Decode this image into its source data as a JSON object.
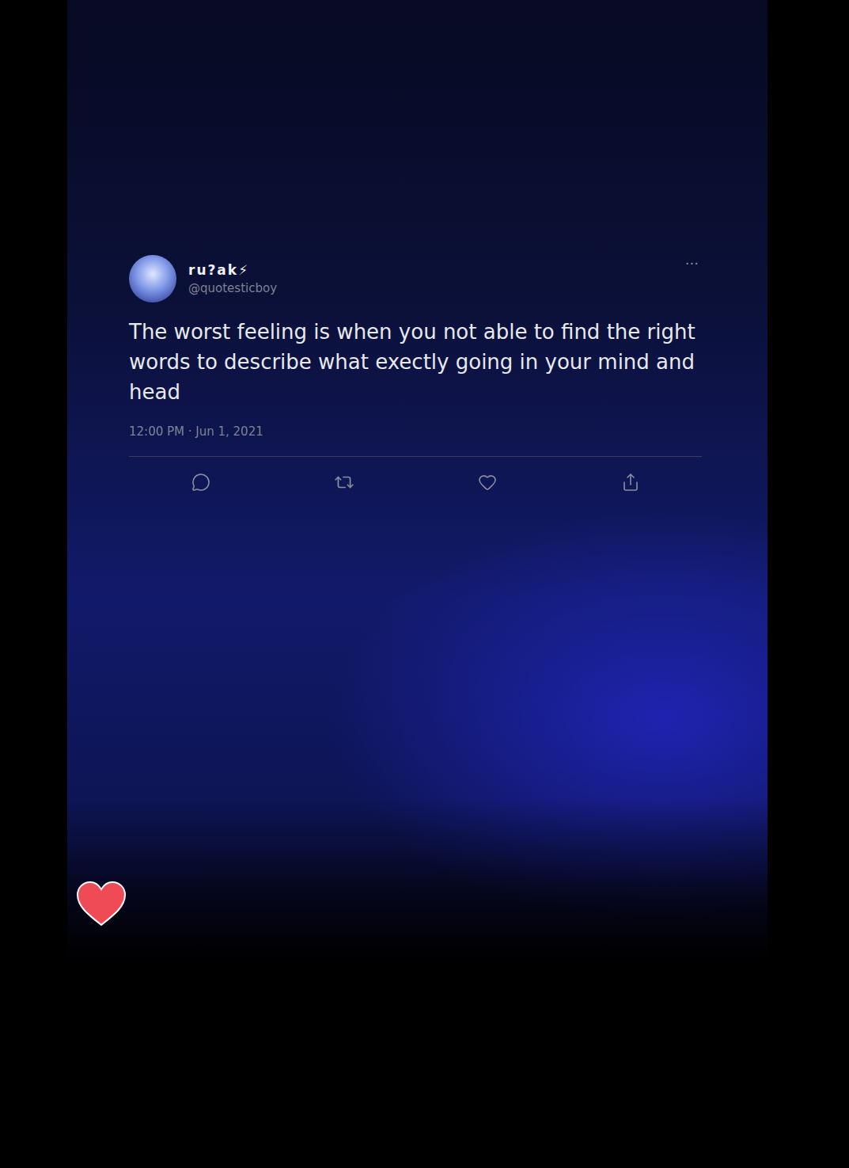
{
  "tweet": {
    "display_name": "ru?ak⚡",
    "handle": "@quotesticboy",
    "more": "···",
    "text": "The worst feeling is when you not able to find the right words to describe what exectly going in your mind and head",
    "timestamp": "12:00 PM · Jun 1, 2021",
    "liked": false
  }
}
